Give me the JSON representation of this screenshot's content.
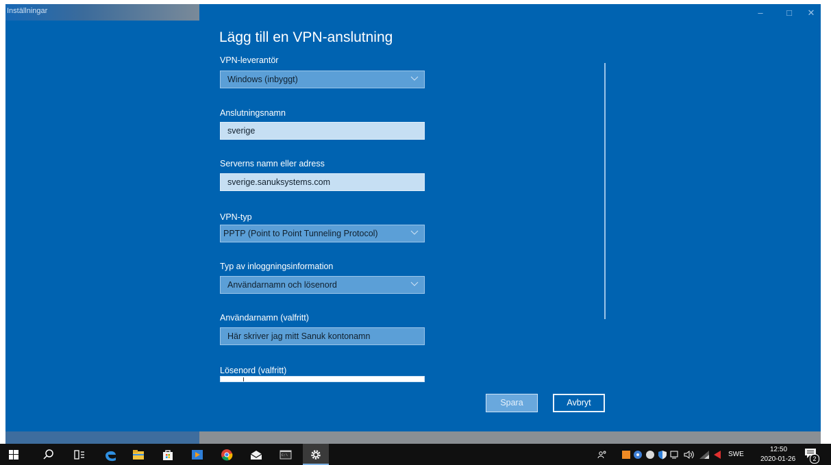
{
  "window": {
    "title": "Inställningar",
    "controls": {
      "minimize": "–",
      "maximize": "□",
      "close": "✕"
    }
  },
  "page": {
    "heading": "Lägg till en VPN-anslutning"
  },
  "form": {
    "vpn_provider": {
      "label": "VPN-leverantör",
      "value": "Windows (inbyggt)"
    },
    "connection_name": {
      "label": "Anslutningsnamn",
      "value": "sverige"
    },
    "server": {
      "label": "Serverns namn eller adress",
      "value": "sverige.sanuksystems.com"
    },
    "vpn_type": {
      "label": "VPN-typ",
      "value": "PPTP (Point to Point Tunneling Protocol)"
    },
    "signin_type": {
      "label": "Typ av inloggningsinformation",
      "value": "Användarnamn och lösenord"
    },
    "username": {
      "label": "Användarnamn (valfritt)",
      "value": "Här skriver jag mitt Sanuk kontonamn"
    },
    "password": {
      "label": "Lösenord (valfritt)",
      "value": ""
    }
  },
  "buttons": {
    "save": "Spara",
    "cancel": "Avbryt"
  },
  "taskbar": {
    "language": "SWE",
    "time": "12:50",
    "date": "2020-01-26",
    "notification_count": "2"
  },
  "colors": {
    "accent": "#0063b1",
    "dropdown_bg": "#5b9fd7",
    "textbox_bg": "#c6dff3",
    "taskbar_bg": "#101010"
  }
}
